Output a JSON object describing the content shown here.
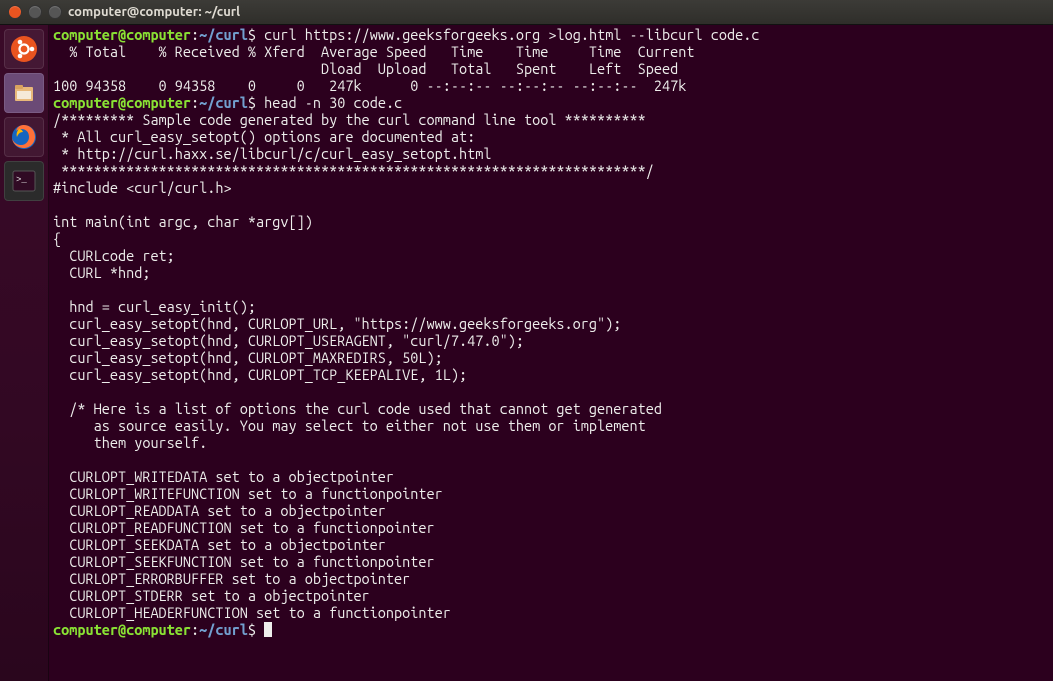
{
  "window_title": "computer@computer: ~/curl",
  "prompt": {
    "userhost": "computer@computer",
    "colon": ":",
    "path": "~/curl",
    "dollar": "$"
  },
  "commands": {
    "cmd1": " curl https://www.geeksforgeeks.org >log.html --libcurl code.c",
    "cmd2": " head -n 30 code.c",
    "cmd3": " "
  },
  "output1": "  % Total    % Received % Xferd  Average Speed   Time    Time     Time  Current\n                                 Dload  Upload   Total   Spent    Left  Speed\n100 94358    0 94358    0     0   247k      0 --:--:-- --:--:-- --:--:--  247k",
  "output2": "/********* Sample code generated by the curl command line tool **********\n * All curl_easy_setopt() options are documented at:\n * http://curl.haxx.se/libcurl/c/curl_easy_setopt.html\n ************************************************************************/\n#include <curl/curl.h>\n\nint main(int argc, char *argv[])\n{\n  CURLcode ret;\n  CURL *hnd;\n\n  hnd = curl_easy_init();\n  curl_easy_setopt(hnd, CURLOPT_URL, \"https://www.geeksforgeeks.org\");\n  curl_easy_setopt(hnd, CURLOPT_USERAGENT, \"curl/7.47.0\");\n  curl_easy_setopt(hnd, CURLOPT_MAXREDIRS, 50L);\n  curl_easy_setopt(hnd, CURLOPT_TCP_KEEPALIVE, 1L);\n\n  /* Here is a list of options the curl code used that cannot get generated\n     as source easily. You may select to either not use them or implement\n     them yourself.\n\n  CURLOPT_WRITEDATA set to a objectpointer\n  CURLOPT_WRITEFUNCTION set to a functionpointer\n  CURLOPT_READDATA set to a objectpointer\n  CURLOPT_READFUNCTION set to a functionpointer\n  CURLOPT_SEEKDATA set to a objectpointer\n  CURLOPT_SEEKFUNCTION set to a functionpointer\n  CURLOPT_ERRORBUFFER set to a objectpointer\n  CURLOPT_STDERR set to a objectpointer\n  CURLOPT_HEADERFUNCTION set to a functionpointer"
}
